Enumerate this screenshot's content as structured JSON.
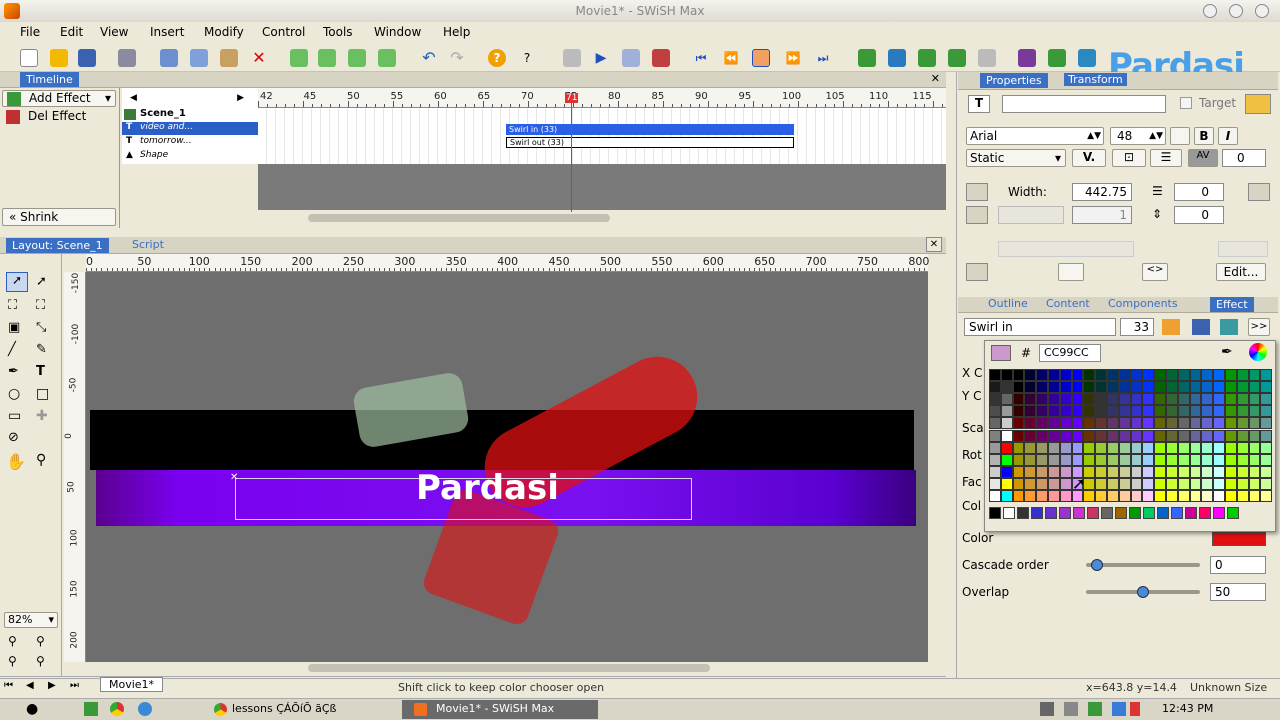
{
  "window": {
    "title": "Movie1* - SWiSH Max",
    "logo_text": "Pardasi"
  },
  "menu": [
    "File",
    "Edit",
    "View",
    "Insert",
    "Modify",
    "Control",
    "Tools",
    "Window",
    "Help"
  ],
  "timeline": {
    "tab": "Timeline",
    "add_effect": "Add Effect",
    "del_effect": "Del Effect",
    "shrink": "Shrink",
    "scene": "Scene_1",
    "layers": [
      "video and...",
      "tomorrow...",
      "Shape"
    ],
    "frame_labels": [
      "42",
      "45",
      "50",
      "55",
      "60",
      "65",
      "70",
      "75",
      "80",
      "85",
      "90",
      "95",
      "100",
      "105",
      "110",
      "115"
    ],
    "current_frame": "71",
    "effect_bars": [
      "Swirl in (33)",
      "Swirl out (33)"
    ]
  },
  "layout": {
    "tabs": [
      "Layout: Scene_1",
      "Script"
    ],
    "ruler_h": [
      "0",
      "50",
      "100",
      "150",
      "200",
      "250",
      "300",
      "350",
      "400",
      "450",
      "500",
      "550",
      "600",
      "650",
      "700",
      "750",
      "800"
    ],
    "ruler_v": [
      "-150",
      "-100",
      "-50",
      "0",
      "50",
      "100",
      "150",
      "200"
    ],
    "zoom": "82%",
    "scene_text": "Pardasi",
    "bottom_tab": "Movie1*"
  },
  "properties": {
    "tabs": [
      "Properties",
      "Transform"
    ],
    "target_label": "Target",
    "font": "Arial",
    "size": "48",
    "text_type": "Static",
    "spacing_1": "0",
    "width_label": "Width:",
    "width_value": "442.75",
    "spacing_2": "0",
    "spacing_3": "1",
    "spacing_4": "0",
    "edit_button": "Edit..."
  },
  "effect_panel": {
    "tabs": [
      "Outline",
      "Content",
      "Components",
      "Effect"
    ],
    "effect_name": "Swirl in",
    "frames": "33",
    "hex_color": "CC99CC",
    "labels": [
      "X C",
      "Y C",
      "Sca",
      "Rot",
      "Fac",
      "Col",
      "Color"
    ],
    "cascade_label": "Cascade order",
    "cascade_value": "0",
    "cascade_level": 0.05,
    "overlap_label": "Overlap",
    "overlap_value": "50",
    "overlap_level": 0.5
  },
  "status": {
    "message": "Shift click to keep color chooser open",
    "coords": "x=643.8 y=14.4",
    "size": "Unknown Size"
  },
  "taskbar": {
    "items": [
      "lessons ÇÁÕíÕ ãÇß",
      "Movie1* - SWiSH Max"
    ],
    "clock": "12:43 PM"
  },
  "colors": {
    "accent": "#3a6fc4",
    "stage": "#6e6e6e",
    "purple": "#7a00f0",
    "red": "#e01010"
  }
}
